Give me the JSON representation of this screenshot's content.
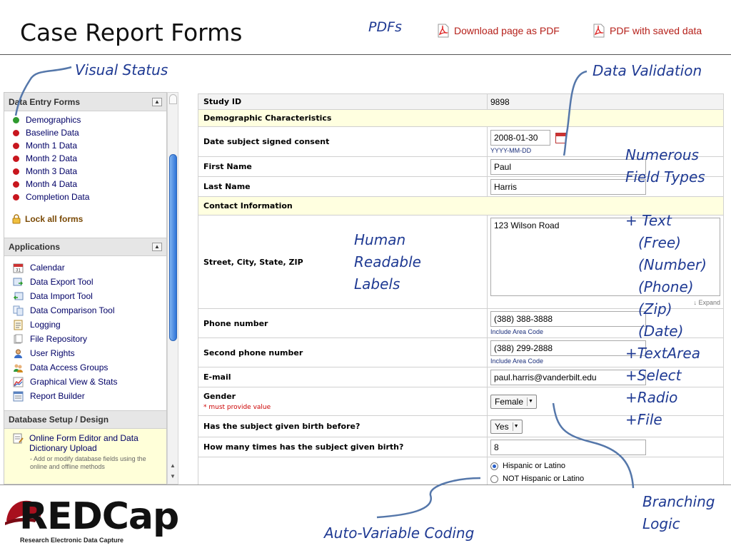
{
  "slide": {
    "title": "Case Report Forms",
    "pdfs_label": "PDFs",
    "download_pdf": "Download page as PDF",
    "pdf_saved": "PDF with saved data"
  },
  "callouts": {
    "visual_status": "Visual Status",
    "data_validation": "Data Validation",
    "numerous_field_types": [
      "Numerous",
      "Field Types"
    ],
    "field_type_list": [
      "+ Text",
      "(Free)",
      "(Number)",
      "(Phone)",
      "(Zip)",
      "(Date)",
      "+TextArea",
      "+Select",
      "+Radio",
      "+File"
    ],
    "human_readable_labels": [
      "Human",
      "Readable",
      "Labels"
    ],
    "branching_logic": [
      "Branching",
      "Logic"
    ],
    "auto_variable_coding": "Auto-Variable Coding"
  },
  "sidebar": {
    "data_entry_header": "Data Entry Forms",
    "forms": [
      {
        "label": "Demographics",
        "status_color": "#2e9a2e"
      },
      {
        "label": "Baseline Data",
        "status_color": "#c8161e"
      },
      {
        "label": "Month 1 Data",
        "status_color": "#c8161e"
      },
      {
        "label": "Month 2 Data",
        "status_color": "#c8161e"
      },
      {
        "label": "Month 3 Data",
        "status_color": "#c8161e"
      },
      {
        "label": "Month 4 Data",
        "status_color": "#c8161e"
      },
      {
        "label": "Completion Data",
        "status_color": "#c8161e"
      }
    ],
    "lock_all": "Lock all forms",
    "applications_header": "Applications",
    "apps": [
      {
        "label": "Calendar",
        "icon": "calendar-icon"
      },
      {
        "label": "Data Export Tool",
        "icon": "export-icon"
      },
      {
        "label": "Data Import Tool",
        "icon": "import-icon"
      },
      {
        "label": "Data Comparison Tool",
        "icon": "comparison-icon"
      },
      {
        "label": "Logging",
        "icon": "logging-icon"
      },
      {
        "label": "File Repository",
        "icon": "file-repository-icon"
      },
      {
        "label": "User Rights",
        "icon": "user-icon"
      },
      {
        "label": "Data Access Groups",
        "icon": "groups-icon"
      },
      {
        "label": "Graphical View & Stats",
        "icon": "chart-icon"
      },
      {
        "label": "Report Builder",
        "icon": "report-icon"
      }
    ],
    "db_header": "Database Setup / Design",
    "db_item": "Online Form Editor and Data Dictionary Upload",
    "db_desc": "- Add or modify database fields using the online and offline methods"
  },
  "form": {
    "study_id_label": "Study ID",
    "study_id_value": "9898",
    "section_demographic": "Demographic Characteristics",
    "consent_label": "Date subject signed consent",
    "consent_value": "2008-01-30",
    "date_format": "YYYY-MM-DD",
    "first_name_label": "First Name",
    "first_name_value": "Paul",
    "last_name_label": "Last Name",
    "last_name_value": "Harris",
    "section_contact": "Contact Information",
    "address_label": "Street, City, State, ZIP",
    "address_value": "123 Wilson Road",
    "expand_label": "↓ Expand",
    "phone_label": "Phone number",
    "phone_value": "(388) 388-3888",
    "phone_hint": "Include Area Code",
    "phone2_label": "Second phone number",
    "phone2_value": "(388) 299-2888",
    "phone2_hint": "Include Area Code",
    "email_label": "E-mail",
    "email_value": "paul.harris@vanderbilt.edu",
    "gender_label": "Gender",
    "gender_required": "* must provide value",
    "gender_value": "Female",
    "birth_before_label": "Has the subject given birth before?",
    "birth_before_value": "Yes",
    "birth_count_label": "How many times has the subject given birth?",
    "birth_count_value": "8",
    "ethnicity_options": [
      "Hispanic or Latino",
      "NOT Hispanic or Latino"
    ]
  },
  "logo": {
    "name": "REDCap",
    "tagline": "Research Electronic Data Capture"
  },
  "colors": {
    "callout": "#1f3a93",
    "section_header": "#ffffe0",
    "status_complete": "#2e9a2e",
    "status_incomplete": "#c8161e",
    "logo_red": "#a8101e"
  }
}
